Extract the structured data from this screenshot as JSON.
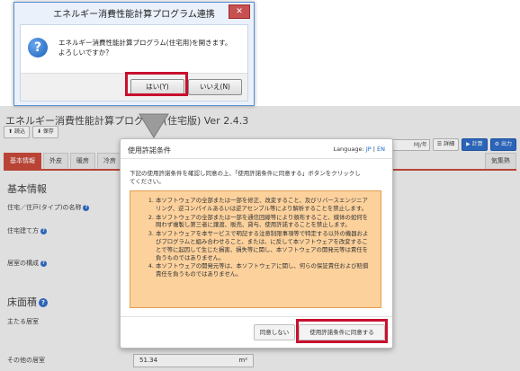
{
  "dialog": {
    "title": "エネルギー消費性能計算プログラム連携",
    "close_label": "✕",
    "message_line1": "エネルギー消費性能計算プログラム(住宅用)を開きます。",
    "message_line2": "よろしいですか？",
    "yes_label": "はい(Y)",
    "no_label": "いいえ(N)"
  },
  "app": {
    "title": "エネルギー消費性能計算プログラム(住宅版) Ver 2.4.3",
    "toolbar": {
      "load_label": "読込",
      "save_label": "保存"
    },
    "right_toolbar": {
      "unit_label": "MJ/年",
      "detail_label": "詳細",
      "calc_label": "計算",
      "output_label": "出力"
    },
    "tabs": [
      "基本情報",
      "外皮",
      "暖房",
      "冷房"
    ],
    "tab_right": [
      "気集熱"
    ],
    "section_basic": "基本情報",
    "row_name": "住宅／住戸(タイプ)の名称",
    "row_build": "住宅建て方",
    "row_region": "居室の構成",
    "section_floor": "床面積",
    "row_main": "主たる居室",
    "row_other": "その他の居室",
    "other_value": "51.34",
    "other_unit": "m²"
  },
  "modal": {
    "title": "使用許諾条件",
    "language_label": "Language:",
    "lang_jp": "JP",
    "lang_sep": "|",
    "lang_en": "EN",
    "desc_line1": "下記の使用許諾条件を確認し同意の上、「使用許諾条件に同意する」ボタンをクリックし",
    "desc_line2": "てください。",
    "terms": [
      "本ソフトウェアの全部または一部を修正、改変すること、及びリバースエンジニアリング、逆コンパイルあるいは逆アセンブル等により解析することを禁止します。",
      "本ソフトウェアの全部または一部を通信回線等により頒布すること、媒体の如何を問わず複製し第三者に譲渡、販売、貸与、使用許諾することを禁止します。",
      "本ソフトウェアを本サービスで明記する注意制限事項等で特定する以外の機器およびプログラムと組み合わせること、または、に反して本ソフトウェアを改変することで等に起因して生じた損害、損失等に関し、本ソフトウェアの開発元等は責任を負うものではありません。",
      "本ソフトウェアの開発元等は、本ソフトウェアに関し、何らの保証責任および賠償責任を負うものではありません。"
    ],
    "disagree_label": "同意しない",
    "agree_label": "使用許諾条件に同意する"
  },
  "colors": {
    "highlight": "#c8102e",
    "accent_tab": "#c94a3a",
    "terms_bg": "#fcd19c",
    "link": "#1a66c9"
  }
}
